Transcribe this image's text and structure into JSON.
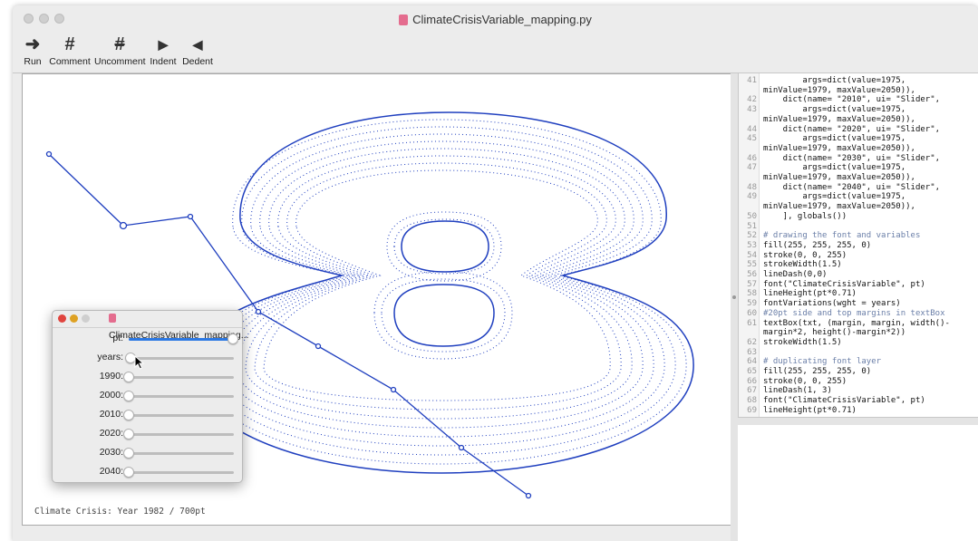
{
  "window": {
    "title": "ClimateCrisisVariable_mapping.py"
  },
  "toolbar": {
    "run": "Run",
    "comment": "Comment",
    "uncomment": "Uncomment",
    "indent": "Indent",
    "dedent": "Dedent"
  },
  "canvas": {
    "status_text": "Climate Crisis: Year 1982 / 700pt",
    "glyph": "8"
  },
  "panel": {
    "title": "ClimateCrisisVariable_mapping...",
    "sliders": [
      {
        "label": "pt:",
        "value": 0.99
      },
      {
        "label": "years:",
        "value": 0.02
      },
      {
        "label": "1990:",
        "value": 0.0
      },
      {
        "label": "2000:",
        "value": 0.0
      },
      {
        "label": "2010:",
        "value": 0.0
      },
      {
        "label": "2020:",
        "value": 0.0
      },
      {
        "label": "2030:",
        "value": 0.0
      },
      {
        "label": "2040:",
        "value": 0.0
      }
    ]
  },
  "code": [
    {
      "ln": "41",
      "text": "        args=dict(value=1975,"
    },
    {
      "ln": "",
      "text": "minValue=1979, maxValue=2050)),"
    },
    {
      "ln": "42",
      "text": "    dict(name= \"2010\", ui= \"Slider\","
    },
    {
      "ln": "43",
      "text": "        args=dict(value=1975,"
    },
    {
      "ln": "",
      "text": "minValue=1979, maxValue=2050)),"
    },
    {
      "ln": "44",
      "text": "    dict(name= \"2020\", ui= \"Slider\","
    },
    {
      "ln": "45",
      "text": "        args=dict(value=1975,"
    },
    {
      "ln": "",
      "text": "minValue=1979, maxValue=2050)),"
    },
    {
      "ln": "46",
      "text": "    dict(name= \"2030\", ui= \"Slider\","
    },
    {
      "ln": "47",
      "text": "        args=dict(value=1975,"
    },
    {
      "ln": "",
      "text": "minValue=1979, maxValue=2050)),"
    },
    {
      "ln": "48",
      "text": "    dict(name= \"2040\", ui= \"Slider\","
    },
    {
      "ln": "49",
      "text": "        args=dict(value=1975,"
    },
    {
      "ln": "",
      "text": "minValue=1979, maxValue=2050)),"
    },
    {
      "ln": "50",
      "text": "    ], globals())"
    },
    {
      "ln": "51",
      "text": ""
    },
    {
      "ln": "52",
      "text": "# drawing the font and variables"
    },
    {
      "ln": "53",
      "text": "fill(255, 255, 255, 0)"
    },
    {
      "ln": "54",
      "text": "stroke(0, 0, 255)"
    },
    {
      "ln": "55",
      "text": "strokeWidth(1.5)"
    },
    {
      "ln": "56",
      "text": "lineDash(0,0)"
    },
    {
      "ln": "57",
      "text": "font(\"ClimateCrisisVariable\", pt)"
    },
    {
      "ln": "58",
      "text": "lineHeight(pt*0.71)"
    },
    {
      "ln": "59",
      "text": "fontVariations(wght = years)"
    },
    {
      "ln": "60",
      "text": "#20pt side and top margins in textBox"
    },
    {
      "ln": "61",
      "text": "textBox(txt, (margin, margin, width()-"
    },
    {
      "ln": "",
      "text": "margin*2, height()-margin*2))"
    },
    {
      "ln": "62",
      "text": "strokeWidth(1.5)"
    },
    {
      "ln": "63",
      "text": ""
    },
    {
      "ln": "64",
      "text": "# duplicating font layer"
    },
    {
      "ln": "65",
      "text": "fill(255, 255, 255, 0)"
    },
    {
      "ln": "66",
      "text": "stroke(0, 0, 255)"
    },
    {
      "ln": "67",
      "text": "lineDash(1, 3)"
    },
    {
      "ln": "68",
      "text": "font(\"ClimateCrisisVariable\", pt)"
    },
    {
      "ln": "69",
      "text": "lineHeight(pt*0.71)"
    }
  ],
  "colors": {
    "stroke": "#1f3fbf",
    "accent": "#2b78e4"
  }
}
